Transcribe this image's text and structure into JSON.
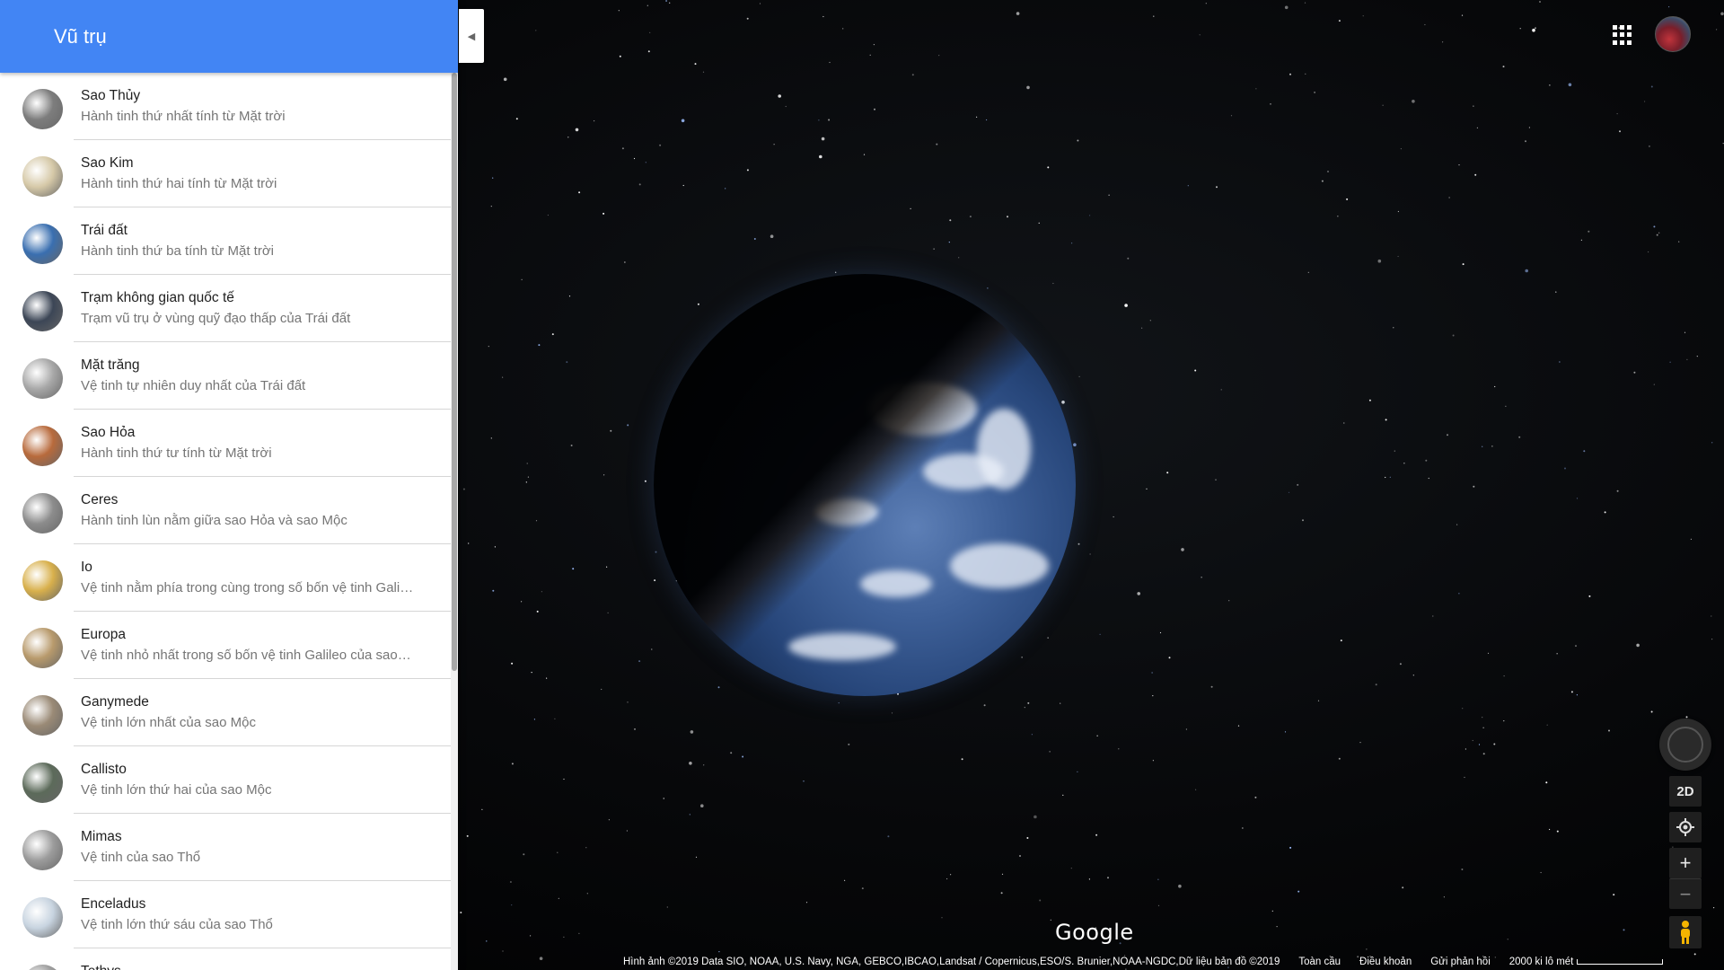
{
  "panel": {
    "title": "Vũ trụ",
    "items": [
      {
        "name": "Sao Thủy",
        "desc": "Hành tinh thứ nhất tính từ Mặt trời",
        "color": "#7d7d7d"
      },
      {
        "name": "Sao Kim",
        "desc": "Hành tinh thứ hai tính từ Mặt trời",
        "color": "#d6c9a8"
      },
      {
        "name": "Trái đất",
        "desc": "Hành tinh thứ ba tính từ Mặt trời",
        "color": "#3a6fb0"
      },
      {
        "name": "Trạm không gian quốc tế",
        "desc": "Trạm vũ trụ ở vùng quỹ đạo thấp của Trái đất",
        "color": "#3c4656"
      },
      {
        "name": "Mặt trăng",
        "desc": "Vệ tinh tự nhiên duy nhất của Trái đất",
        "color": "#a8a8a8"
      },
      {
        "name": "Sao Hỏa",
        "desc": "Hành tinh thứ tư tính từ Mặt trời",
        "color": "#b86a3c"
      },
      {
        "name": "Ceres",
        "desc": "Hành tinh lùn nằm giữa sao Hỏa và sao Mộc",
        "color": "#8c8c8c"
      },
      {
        "name": "Io",
        "desc": "Vệ tinh nằm phía trong cùng trong số bốn vệ tinh Gali…",
        "color": "#d8b04c"
      },
      {
        "name": "Europa",
        "desc": "Vệ tinh nhỏ nhất trong số bốn vệ tinh Galileo của sao…",
        "color": "#b89a6c"
      },
      {
        "name": "Ganymede",
        "desc": "Vệ tinh lớn nhất của sao Mộc",
        "color": "#9a8a76"
      },
      {
        "name": "Callisto",
        "desc": "Vệ tinh lớn thứ hai của sao Mộc",
        "color": "#5c6a5a"
      },
      {
        "name": "Mimas",
        "desc": "Vệ tinh của sao Thổ",
        "color": "#9c9c9c"
      },
      {
        "name": "Enceladus",
        "desc": "Vệ tinh lớn thứ sáu của sao Thổ",
        "color": "#c8d4e0"
      },
      {
        "name": "Tethys",
        "desc": "",
        "color": "#a0a0a0"
      }
    ]
  },
  "controls": {
    "view_toggle": "2D",
    "zoom_in": "+",
    "zoom_out": "−"
  },
  "map": {
    "logo": "Google",
    "attribution": "Hình ảnh ©2019 Data SIO, NOAA, U.S. Navy, NGA, GEBCO,IBCAO,Landsat / Copernicus,ESO/S. Brunier,NOAA-NGDC,Dữ liệu bản đồ ©2019",
    "global": "Toàn cầu",
    "terms": "Điều khoản",
    "feedback": "Gửi phản hồi",
    "scale": "2000 ki lô mét"
  },
  "icons": {
    "collapse": "chevron-left-icon",
    "apps": "apps-grid-icon",
    "locate": "my-location-icon",
    "pegman": "pegman-icon",
    "compass": "compass-icon"
  }
}
